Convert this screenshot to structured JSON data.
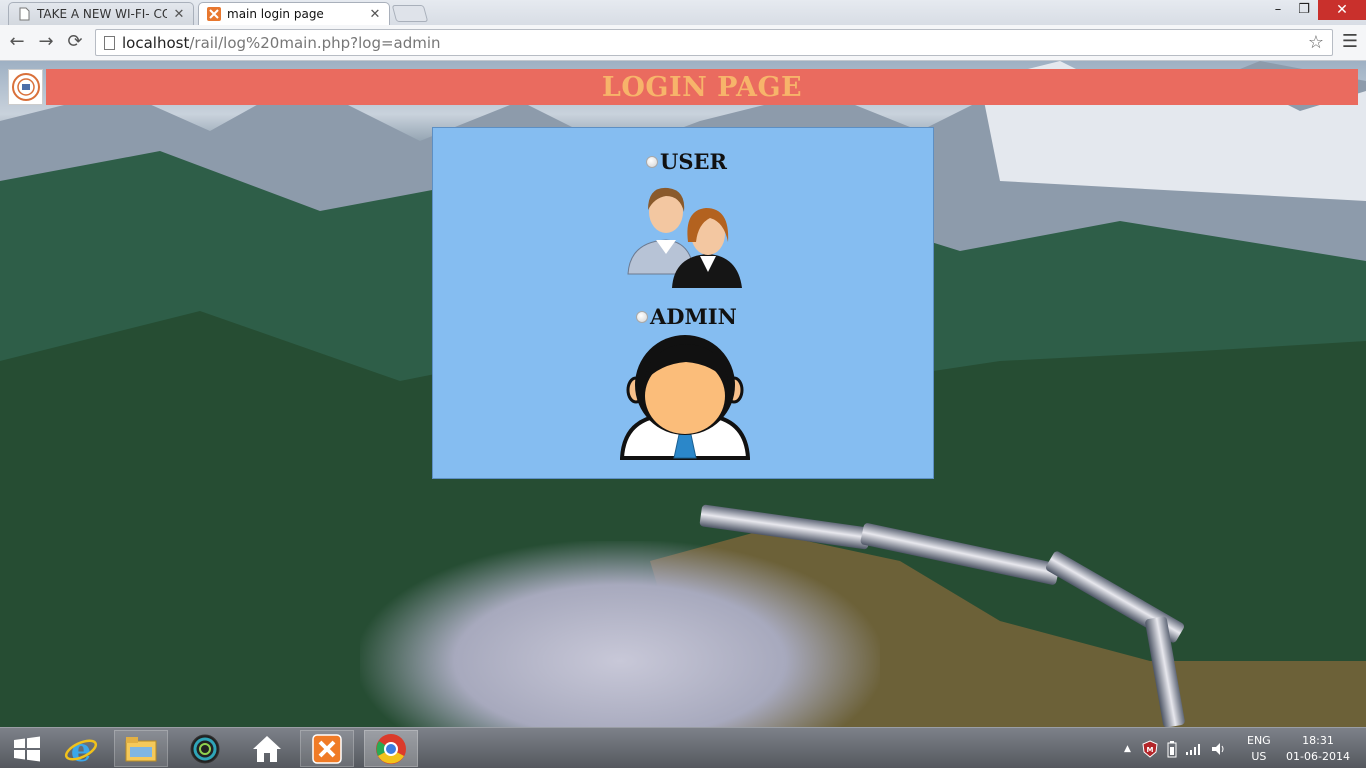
{
  "browser": {
    "tabs": [
      {
        "title": "TAKE A NEW WI-FI- CONN",
        "active": false
      },
      {
        "title": "main login page",
        "active": true
      }
    ],
    "url_host": "localhost",
    "url_path": "/rail/log%20main.php?log=admin",
    "window_controls": {
      "minimize": "–",
      "maximize": "❐",
      "close": "✕"
    }
  },
  "page": {
    "header_title": "LOGIN PAGE",
    "header_color": "#ea6b5f",
    "header_text_color": "#f7b46a",
    "box_color": "#85bdf1",
    "options": [
      {
        "label": "USER",
        "icon": "users-avatar-icon",
        "selected": false
      },
      {
        "label": "ADMIN",
        "icon": "admin-avatar-icon",
        "selected": false
      }
    ]
  },
  "taskbar": {
    "apps": [
      "start-icon",
      "internet-explorer-icon",
      "file-explorer-icon",
      "app-circle-icon",
      "home-icon",
      "xampp-icon",
      "chrome-icon"
    ],
    "language_top": "ENG",
    "language_bottom": "US",
    "time": "18:31",
    "date": "01-06-2014"
  }
}
